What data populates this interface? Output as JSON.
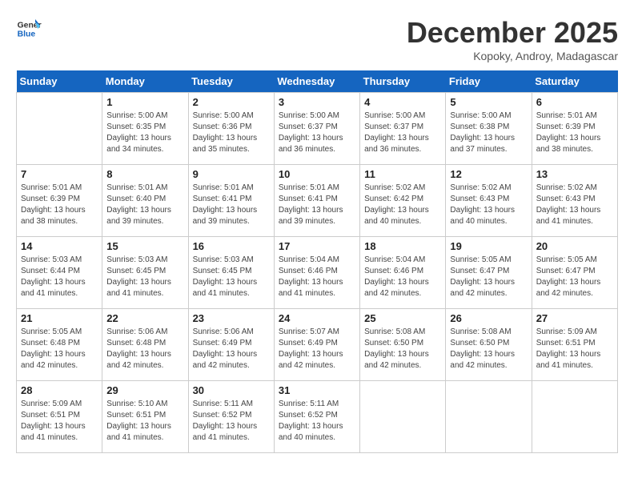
{
  "header": {
    "logo_line1": "General",
    "logo_line2": "Blue",
    "month": "December 2025",
    "location": "Kopoky, Androy, Madagascar"
  },
  "days_of_week": [
    "Sunday",
    "Monday",
    "Tuesday",
    "Wednesday",
    "Thursday",
    "Friday",
    "Saturday"
  ],
  "weeks": [
    [
      {
        "day": "",
        "sunrise": "",
        "sunset": "",
        "daylight": ""
      },
      {
        "day": "1",
        "sunrise": "Sunrise: 5:00 AM",
        "sunset": "Sunset: 6:35 PM",
        "daylight": "Daylight: 13 hours and 34 minutes."
      },
      {
        "day": "2",
        "sunrise": "Sunrise: 5:00 AM",
        "sunset": "Sunset: 6:36 PM",
        "daylight": "Daylight: 13 hours and 35 minutes."
      },
      {
        "day": "3",
        "sunrise": "Sunrise: 5:00 AM",
        "sunset": "Sunset: 6:37 PM",
        "daylight": "Daylight: 13 hours and 36 minutes."
      },
      {
        "day": "4",
        "sunrise": "Sunrise: 5:00 AM",
        "sunset": "Sunset: 6:37 PM",
        "daylight": "Daylight: 13 hours and 36 minutes."
      },
      {
        "day": "5",
        "sunrise": "Sunrise: 5:00 AM",
        "sunset": "Sunset: 6:38 PM",
        "daylight": "Daylight: 13 hours and 37 minutes."
      },
      {
        "day": "6",
        "sunrise": "Sunrise: 5:01 AM",
        "sunset": "Sunset: 6:39 PM",
        "daylight": "Daylight: 13 hours and 38 minutes."
      }
    ],
    [
      {
        "day": "7",
        "sunrise": "Sunrise: 5:01 AM",
        "sunset": "Sunset: 6:39 PM",
        "daylight": "Daylight: 13 hours and 38 minutes."
      },
      {
        "day": "8",
        "sunrise": "Sunrise: 5:01 AM",
        "sunset": "Sunset: 6:40 PM",
        "daylight": "Daylight: 13 hours and 39 minutes."
      },
      {
        "day": "9",
        "sunrise": "Sunrise: 5:01 AM",
        "sunset": "Sunset: 6:41 PM",
        "daylight": "Daylight: 13 hours and 39 minutes."
      },
      {
        "day": "10",
        "sunrise": "Sunrise: 5:01 AM",
        "sunset": "Sunset: 6:41 PM",
        "daylight": "Daylight: 13 hours and 39 minutes."
      },
      {
        "day": "11",
        "sunrise": "Sunrise: 5:02 AM",
        "sunset": "Sunset: 6:42 PM",
        "daylight": "Daylight: 13 hours and 40 minutes."
      },
      {
        "day": "12",
        "sunrise": "Sunrise: 5:02 AM",
        "sunset": "Sunset: 6:43 PM",
        "daylight": "Daylight: 13 hours and 40 minutes."
      },
      {
        "day": "13",
        "sunrise": "Sunrise: 5:02 AM",
        "sunset": "Sunset: 6:43 PM",
        "daylight": "Daylight: 13 hours and 41 minutes."
      }
    ],
    [
      {
        "day": "14",
        "sunrise": "Sunrise: 5:03 AM",
        "sunset": "Sunset: 6:44 PM",
        "daylight": "Daylight: 13 hours and 41 minutes."
      },
      {
        "day": "15",
        "sunrise": "Sunrise: 5:03 AM",
        "sunset": "Sunset: 6:45 PM",
        "daylight": "Daylight: 13 hours and 41 minutes."
      },
      {
        "day": "16",
        "sunrise": "Sunrise: 5:03 AM",
        "sunset": "Sunset: 6:45 PM",
        "daylight": "Daylight: 13 hours and 41 minutes."
      },
      {
        "day": "17",
        "sunrise": "Sunrise: 5:04 AM",
        "sunset": "Sunset: 6:46 PM",
        "daylight": "Daylight: 13 hours and 41 minutes."
      },
      {
        "day": "18",
        "sunrise": "Sunrise: 5:04 AM",
        "sunset": "Sunset: 6:46 PM",
        "daylight": "Daylight: 13 hours and 42 minutes."
      },
      {
        "day": "19",
        "sunrise": "Sunrise: 5:05 AM",
        "sunset": "Sunset: 6:47 PM",
        "daylight": "Daylight: 13 hours and 42 minutes."
      },
      {
        "day": "20",
        "sunrise": "Sunrise: 5:05 AM",
        "sunset": "Sunset: 6:47 PM",
        "daylight": "Daylight: 13 hours and 42 minutes."
      }
    ],
    [
      {
        "day": "21",
        "sunrise": "Sunrise: 5:05 AM",
        "sunset": "Sunset: 6:48 PM",
        "daylight": "Daylight: 13 hours and 42 minutes."
      },
      {
        "day": "22",
        "sunrise": "Sunrise: 5:06 AM",
        "sunset": "Sunset: 6:48 PM",
        "daylight": "Daylight: 13 hours and 42 minutes."
      },
      {
        "day": "23",
        "sunrise": "Sunrise: 5:06 AM",
        "sunset": "Sunset: 6:49 PM",
        "daylight": "Daylight: 13 hours and 42 minutes."
      },
      {
        "day": "24",
        "sunrise": "Sunrise: 5:07 AM",
        "sunset": "Sunset: 6:49 PM",
        "daylight": "Daylight: 13 hours and 42 minutes."
      },
      {
        "day": "25",
        "sunrise": "Sunrise: 5:08 AM",
        "sunset": "Sunset: 6:50 PM",
        "daylight": "Daylight: 13 hours and 42 minutes."
      },
      {
        "day": "26",
        "sunrise": "Sunrise: 5:08 AM",
        "sunset": "Sunset: 6:50 PM",
        "daylight": "Daylight: 13 hours and 42 minutes."
      },
      {
        "day": "27",
        "sunrise": "Sunrise: 5:09 AM",
        "sunset": "Sunset: 6:51 PM",
        "daylight": "Daylight: 13 hours and 41 minutes."
      }
    ],
    [
      {
        "day": "28",
        "sunrise": "Sunrise: 5:09 AM",
        "sunset": "Sunset: 6:51 PM",
        "daylight": "Daylight: 13 hours and 41 minutes."
      },
      {
        "day": "29",
        "sunrise": "Sunrise: 5:10 AM",
        "sunset": "Sunset: 6:51 PM",
        "daylight": "Daylight: 13 hours and 41 minutes."
      },
      {
        "day": "30",
        "sunrise": "Sunrise: 5:11 AM",
        "sunset": "Sunset: 6:52 PM",
        "daylight": "Daylight: 13 hours and 41 minutes."
      },
      {
        "day": "31",
        "sunrise": "Sunrise: 5:11 AM",
        "sunset": "Sunset: 6:52 PM",
        "daylight": "Daylight: 13 hours and 40 minutes."
      },
      {
        "day": "",
        "sunrise": "",
        "sunset": "",
        "daylight": ""
      },
      {
        "day": "",
        "sunrise": "",
        "sunset": "",
        "daylight": ""
      },
      {
        "day": "",
        "sunrise": "",
        "sunset": "",
        "daylight": ""
      }
    ]
  ]
}
